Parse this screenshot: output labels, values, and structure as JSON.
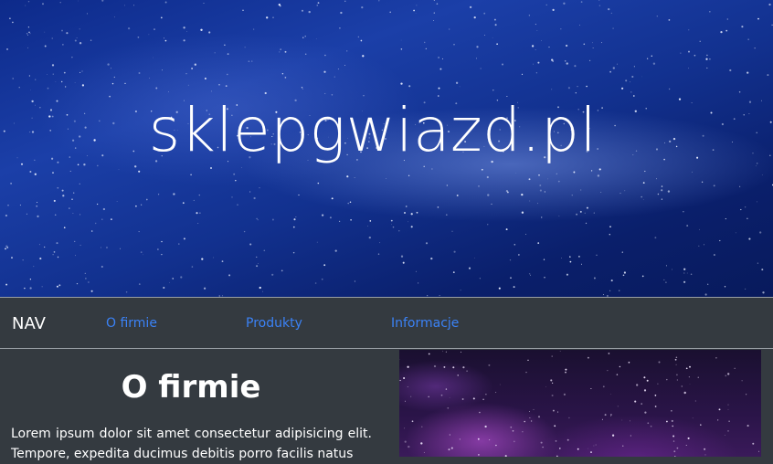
{
  "hero": {
    "title": "sklepgwiazd.pl"
  },
  "nav": {
    "brand": "NAV",
    "links": [
      {
        "label": "O firmie"
      },
      {
        "label": "Produkty"
      },
      {
        "label": "Informacje"
      }
    ]
  },
  "main": {
    "section_title": "O firmie",
    "paragraph": "Lorem ipsum dolor sit amet consectetur adipisicing elit. Tempore, expedita ducimus debitis porro facilis natus"
  },
  "colors": {
    "link": "#3b82f6",
    "background": "#343a40",
    "hero_text": "#ffffff"
  }
}
